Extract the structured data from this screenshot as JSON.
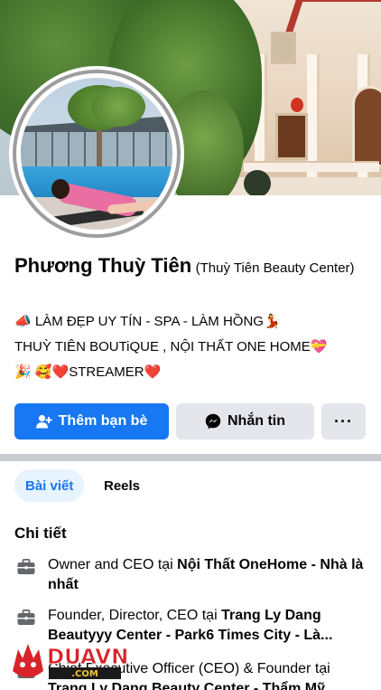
{
  "profile": {
    "name": "Phương Thuỳ Tiên",
    "alternate_name": "(Thuỳ Tiên Beauty Center)",
    "bio_line1": "📣 LÀM ĐẸP UY TÍN - SPA - LÀM HỒNG💃",
    "bio_line2": "THUỲ TIÊN BOUTiQUE , NỘI THẤT ONE HOME💝",
    "bio_line3": "🎉  🥰❤️STREAMER❤️"
  },
  "actions": {
    "add_friend": "Thêm bạn bè",
    "message": "Nhắn tin",
    "more": "···"
  },
  "tabs": [
    {
      "label": "Bài viết",
      "active": true
    },
    {
      "label": "Reels",
      "active": false
    }
  ],
  "details": {
    "title": "Chi tiết",
    "items": [
      {
        "role": "Owner and CEO tại ",
        "org": "Nội Thất OneHome - Nhà là nhất"
      },
      {
        "role": "Founder, Director, CEO tại ",
        "org": "Trang Ly Dang Beautyyy Center - Park6 Times City - Là..."
      },
      {
        "role": "Chief Executive Officer (CEO) & Founder tại ",
        "org": "Trang Ly Dang Beauty Center - Thẩm Mỹ..."
      }
    ]
  },
  "watermark": {
    "brand": "DUAVN",
    "domain": ".COM"
  },
  "colors": {
    "primary": "#1877f2",
    "secondary_button": "#e4e6eb",
    "active_tab_bg": "#e7f3ff",
    "divider": "#c9ccd1",
    "text": "#050505"
  },
  "icons": {
    "add_friend": "person-add-icon",
    "message": "messenger-icon",
    "work": "briefcase-icon"
  }
}
